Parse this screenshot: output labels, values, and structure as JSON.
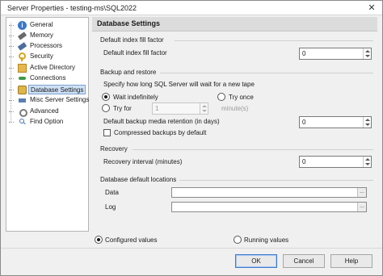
{
  "window": {
    "title": "Server Properties - testing-ms\\SQL2022"
  },
  "nav": {
    "items": [
      {
        "label": "General",
        "icon": "info-icon"
      },
      {
        "label": "Memory",
        "icon": "memory-icon"
      },
      {
        "label": "Processors",
        "icon": "processor-icon"
      },
      {
        "label": "Security",
        "icon": "key-icon"
      },
      {
        "label": "Active Directory",
        "icon": "active-directory-icon"
      },
      {
        "label": "Connections",
        "icon": "connections-icon"
      },
      {
        "label": "Database Settings",
        "icon": "database-icon",
        "selected": true
      },
      {
        "label": "Misc Server Settings",
        "icon": "misc-settings-icon"
      },
      {
        "label": "Advanced",
        "icon": "advanced-icon"
      },
      {
        "label": "Find Option",
        "icon": "find-icon"
      }
    ]
  },
  "content": {
    "header": "Database Settings",
    "fill_factor": {
      "group_title": "Default index fill factor",
      "label": "Default index fill factor",
      "value": "0"
    },
    "backup": {
      "group_title": "Backup and restore",
      "description": "Specify how long SQL Server will wait for a new tape",
      "wait_indefinitely": "Wait indefinitely",
      "try_once": "Try once",
      "try_for": "Try for",
      "try_for_value": "1",
      "minutes_label": "minute(s)",
      "retention_label": "Default backup media retention (in days)",
      "retention_value": "0",
      "compressed_label": "Compressed backups by default"
    },
    "recovery": {
      "group_title": "Recovery",
      "label": "Recovery interval (minutes)",
      "value": "0"
    },
    "locations": {
      "group_title": "Database default locations",
      "data_label": "Data",
      "data_value": "",
      "log_label": "Log",
      "log_value": "",
      "browse_glyph": "..."
    }
  },
  "values_mode": {
    "configured": "Configured values",
    "running": "Running values"
  },
  "buttons": {
    "ok": "OK",
    "cancel": "Cancel",
    "help": "Help"
  }
}
